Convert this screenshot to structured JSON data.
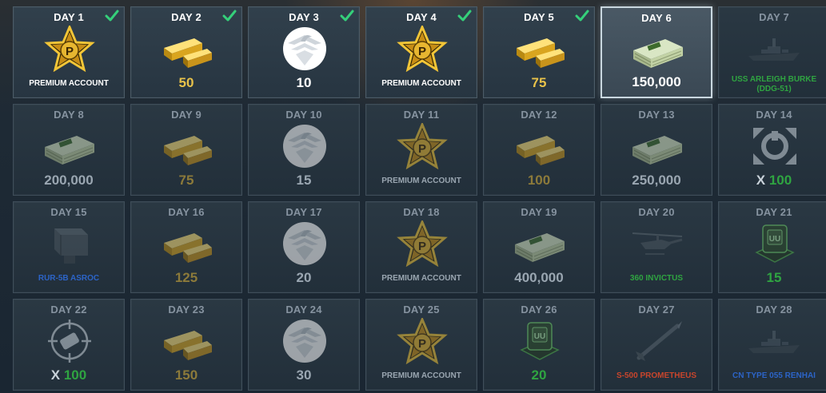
{
  "rewards": [
    {
      "day": "DAY 1",
      "label": "PREMIUM ACCOUNT",
      "icon": "premium-star-icon",
      "color": "white",
      "claimed": true,
      "state": "claimed"
    },
    {
      "day": "DAY 2",
      "label": "50",
      "icon": "gold-bars-icon",
      "color": "gold",
      "claimed": true,
      "state": "claimed"
    },
    {
      "day": "DAY 3",
      "label": "10",
      "icon": "eagle-emblem-icon",
      "color": "white",
      "claimed": true,
      "state": "claimed"
    },
    {
      "day": "DAY 4",
      "label": "PREMIUM ACCOUNT",
      "icon": "premium-star-icon",
      "color": "white",
      "claimed": true,
      "state": "claimed"
    },
    {
      "day": "DAY 5",
      "label": "75",
      "icon": "gold-bars-icon",
      "color": "gold",
      "claimed": true,
      "state": "claimed"
    },
    {
      "day": "DAY 6",
      "label": "150,000",
      "icon": "cash-stack-icon",
      "color": "white",
      "claimed": false,
      "state": "current"
    },
    {
      "day": "DAY 7",
      "label": "USS ARLEIGH BURKE (DDG-51)",
      "icon": "destroyer-ship-icon",
      "color": "green",
      "claimed": false,
      "state": "future"
    },
    {
      "day": "DAY 8",
      "label": "200,000",
      "icon": "cash-stack-icon",
      "color": "white",
      "claimed": false,
      "state": "future"
    },
    {
      "day": "DAY 9",
      "label": "75",
      "icon": "gold-bars-icon",
      "color": "gold",
      "claimed": false,
      "state": "future"
    },
    {
      "day": "DAY 10",
      "label": "15",
      "icon": "eagle-emblem-icon",
      "color": "white",
      "claimed": false,
      "state": "future"
    },
    {
      "day": "DAY 11",
      "label": "PREMIUM ACCOUNT",
      "icon": "premium-star-icon",
      "color": "white",
      "claimed": false,
      "state": "future"
    },
    {
      "day": "DAY 12",
      "label": "100",
      "icon": "gold-bars-icon",
      "color": "gold",
      "claimed": false,
      "state": "future"
    },
    {
      "day": "DAY 13",
      "label": "250,000",
      "icon": "cash-stack-icon",
      "color": "white",
      "claimed": false,
      "state": "future"
    },
    {
      "day": "DAY 14",
      "label": "100",
      "prefix": "X",
      "icon": "repair-kit-icon",
      "color": "green",
      "claimed": false,
      "state": "future"
    },
    {
      "day": "DAY 15",
      "label": "RUR-5B ASROC",
      "icon": "missile-launcher-icon",
      "color": "blue",
      "claimed": false,
      "state": "future"
    },
    {
      "day": "DAY 16",
      "label": "125",
      "icon": "gold-bars-icon",
      "color": "gold",
      "claimed": false,
      "state": "future"
    },
    {
      "day": "DAY 17",
      "label": "20",
      "icon": "eagle-emblem-icon",
      "color": "white",
      "claimed": false,
      "state": "future"
    },
    {
      "day": "DAY 18",
      "label": "PREMIUM ACCOUNT",
      "icon": "premium-star-icon",
      "color": "white",
      "claimed": false,
      "state": "future"
    },
    {
      "day": "DAY 19",
      "label": "400,000",
      "icon": "cash-stack-icon",
      "color": "white",
      "claimed": false,
      "state": "future"
    },
    {
      "day": "DAY 20",
      "label": "360 INVICTUS",
      "icon": "helicopter-icon",
      "color": "green",
      "claimed": false,
      "state": "future"
    },
    {
      "day": "DAY 21",
      "label": "15",
      "icon": "supply-crate-icon",
      "color": "green",
      "claimed": false,
      "state": "future"
    },
    {
      "day": "DAY 22",
      "label": "100",
      "prefix": "X",
      "icon": "targeting-module-icon",
      "color": "green",
      "claimed": false,
      "state": "future"
    },
    {
      "day": "DAY 23",
      "label": "150",
      "icon": "gold-bars-icon",
      "color": "gold",
      "claimed": false,
      "state": "future"
    },
    {
      "day": "DAY 24",
      "label": "30",
      "icon": "eagle-emblem-icon",
      "color": "white",
      "claimed": false,
      "state": "future"
    },
    {
      "day": "DAY 25",
      "label": "PREMIUM ACCOUNT",
      "icon": "premium-star-icon",
      "color": "white",
      "claimed": false,
      "state": "future"
    },
    {
      "day": "DAY 26",
      "label": "20",
      "icon": "supply-crate-icon",
      "color": "green",
      "claimed": false,
      "state": "future"
    },
    {
      "day": "DAY 27",
      "label": "S-500 PROMETHEUS",
      "icon": "missile-icon",
      "color": "red",
      "claimed": false,
      "state": "future"
    },
    {
      "day": "DAY 28",
      "label": "CN TYPE 055 RENHAI",
      "icon": "destroyer-ship-icon",
      "color": "blue",
      "claimed": false,
      "state": "future"
    }
  ]
}
